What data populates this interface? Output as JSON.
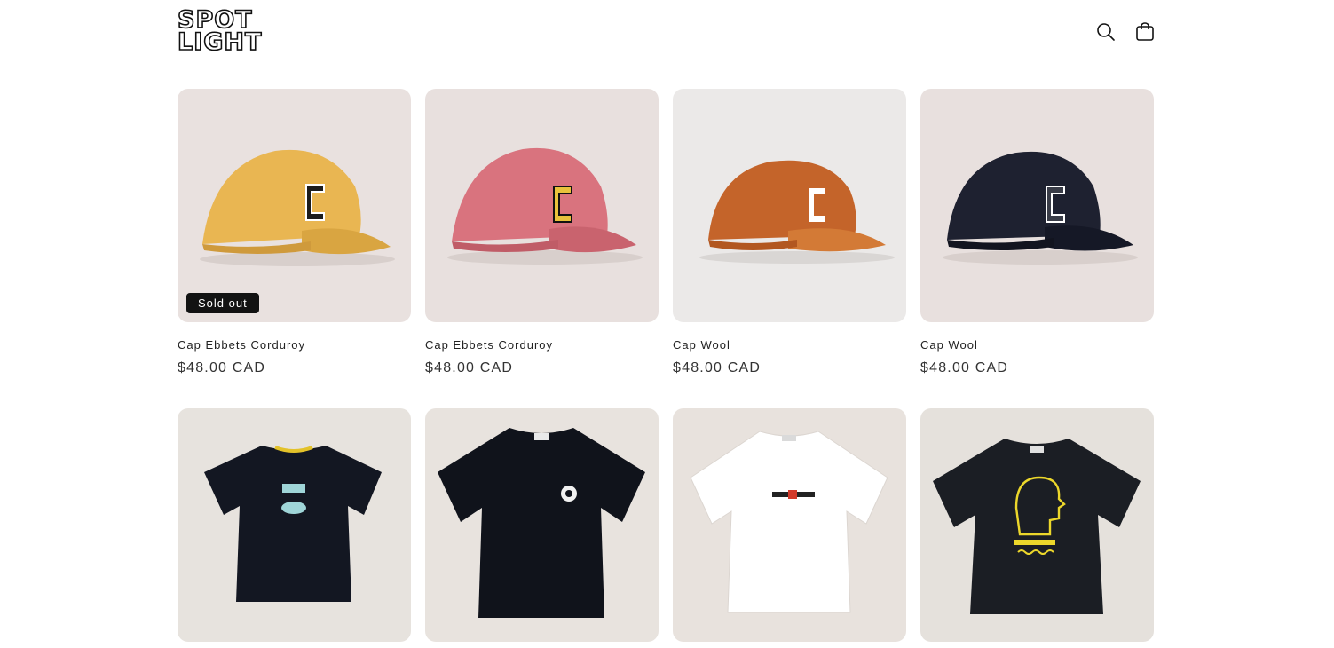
{
  "brand": {
    "line1": "SPOT",
    "line2": "LIGHT"
  },
  "header": {
    "search_icon": "search-icon",
    "cart_icon": "cart-icon"
  },
  "products": [
    {
      "title": "Cap Ebbets Corduroy",
      "price": "$48.00 CAD",
      "badge": "Sold out",
      "image": "yellow-corduroy-cap",
      "cap_color": "#e9b652",
      "bg": "#e9e1df"
    },
    {
      "title": "Cap Ebbets Corduroy",
      "price": "$48.00 CAD",
      "badge": "",
      "image": "pink-corduroy-cap",
      "cap_color": "#d9737e",
      "bg": "#e8e0de"
    },
    {
      "title": "Cap Wool",
      "price": "$48.00 CAD",
      "badge": "",
      "image": "orange-wool-cap",
      "cap_color": "#c4642a",
      "bg": "#ebe9e8"
    },
    {
      "title": "Cap Wool",
      "price": "$48.00 CAD",
      "badge": "",
      "image": "navy-wool-cap",
      "cap_color": "#1e2130",
      "bg": "#e8e0de"
    },
    {
      "image": "black-tshirt-coffee-print",
      "shirt_color": "#131722",
      "bg": "#e7e3de"
    },
    {
      "image": "black-tshirt-chest-logo",
      "shirt_color": "#10131b",
      "bg": "#e8e3de"
    },
    {
      "image": "white-tshirt-coursework",
      "shirt_color": "#ffffff",
      "bg": "#e8e2dd"
    },
    {
      "image": "black-tshirt-never-not-working",
      "shirt_color": "#1b1e24",
      "bg": "#e5e1dc"
    }
  ]
}
